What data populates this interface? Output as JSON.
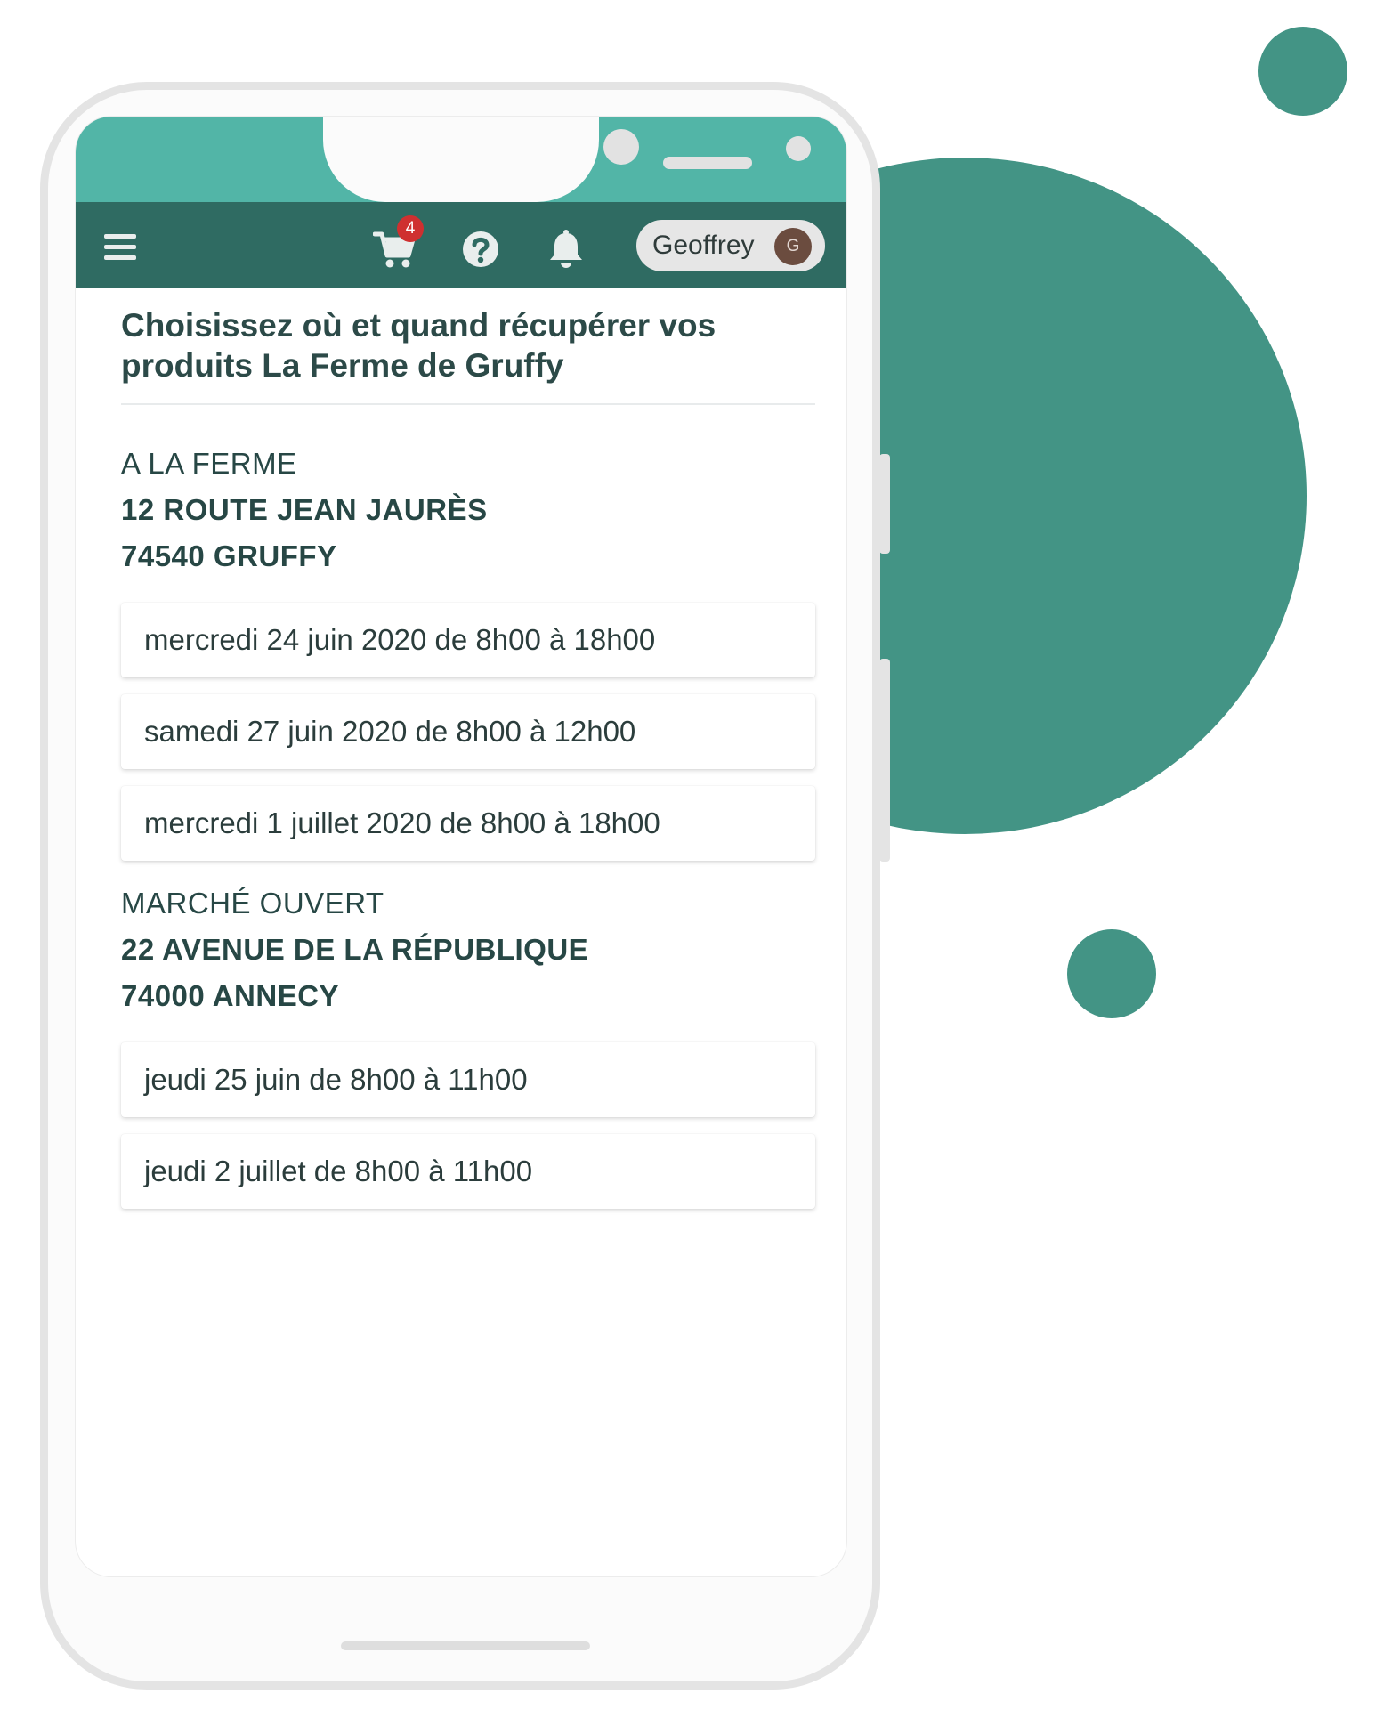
{
  "header": {
    "cart_count": "4",
    "user_name": "Geoffrey",
    "user_initial": "G"
  },
  "page": {
    "title": "Choisissez où et quand récupérer vos produits La Ferme de Gruffy"
  },
  "locations": [
    {
      "name": "A LA FERME",
      "street": "12 ROUTE JEAN JAURÈS",
      "city": "74540 GRUFFY",
      "slots": [
        "mercredi 24 juin 2020 de 8h00 à 18h00",
        "samedi 27 juin 2020 de 8h00 à 12h00",
        "mercredi 1 juillet 2020 de 8h00 à 18h00"
      ]
    },
    {
      "name": "MARCHÉ OUVERT",
      "street": "22 AVENUE DE LA RÉPUBLIQUE",
      "city": "74000 ANNECY",
      "slots": [
        "jeudi 25 juin de 8h00 à 11h00",
        "jeudi 2 juillet de 8h00 à 11h00"
      ]
    }
  ],
  "colors": {
    "accent": "#439485",
    "app_bar": "#2f6b62",
    "status_bar": "#52b5a7",
    "badge": "#cf3030"
  },
  "icons": [
    "menu-icon",
    "cart-icon",
    "help-icon",
    "bell-icon"
  ]
}
